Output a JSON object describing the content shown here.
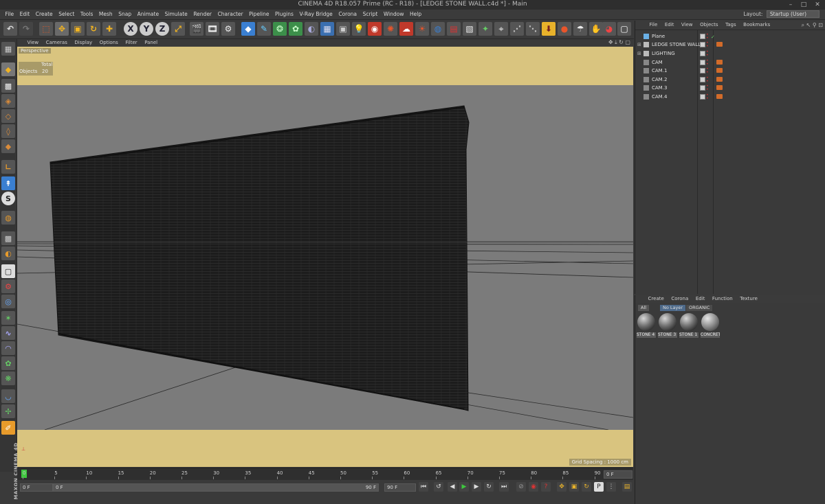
{
  "window": {
    "title": "CINEMA 4D R18.057 Prime (RC - R18) - [LEDGE STONE WALL.c4d *] - Main",
    "minimize": "–",
    "maximize": "□",
    "close": "✕"
  },
  "menubar": {
    "items": [
      "File",
      "Edit",
      "Create",
      "Select",
      "Tools",
      "Mesh",
      "Snap",
      "Animate",
      "Simulate",
      "Render",
      "Character",
      "Pipeline",
      "Plugins",
      "V-Ray Bridge",
      "Corona",
      "Script",
      "Window",
      "Help"
    ],
    "layout_label": "Layout:",
    "layout_value": "Startup (User)"
  },
  "toolbar": {
    "axis_x": "X",
    "axis_y": "Y",
    "axis_z": "Z"
  },
  "viewport": {
    "menu": [
      "View",
      "Cameras",
      "Display",
      "Options",
      "Filter",
      "Panel"
    ],
    "label": "Perspective",
    "hud_total": "Total",
    "hud_objects_label": "Objects",
    "hud_objects_value": "20",
    "grid_spacing": "Grid Spacing : 1000 cm"
  },
  "timeline": {
    "ticks": [
      "0",
      "5",
      "10",
      "15",
      "20",
      "25",
      "30",
      "35",
      "40",
      "45",
      "50",
      "55",
      "60",
      "65",
      "70",
      "75",
      "80",
      "85",
      "90"
    ],
    "current_frame": "0 F"
  },
  "playback": {
    "start_frame": "0 F",
    "min_frame": "0 F",
    "max_frame": "90 F",
    "end_frame": "90 F"
  },
  "object_manager": {
    "menu": [
      "File",
      "Edit",
      "View",
      "Objects",
      "Tags",
      "Bookmarks"
    ],
    "objects": [
      {
        "name": "Plane"
      },
      {
        "name": "LEDGE STONE WALL"
      },
      {
        "name": "LIGHTING"
      },
      {
        "name": "CAM"
      },
      {
        "name": "CAM.1"
      },
      {
        "name": "CAM.2"
      },
      {
        "name": "CAM.3"
      },
      {
        "name": "CAM.4"
      }
    ]
  },
  "material_manager": {
    "menu": [
      "Create",
      "Corona",
      "Edit",
      "Function",
      "Texture"
    ],
    "tabs": [
      "All",
      "No Layer",
      "ORGANIC"
    ],
    "materials": [
      "STONE 4",
      "STONE 3",
      "STONE 1",
      "CONCRETE"
    ]
  },
  "branding": {
    "maxon": "MAXON",
    "cinema4d": "CINEMA 4D"
  }
}
